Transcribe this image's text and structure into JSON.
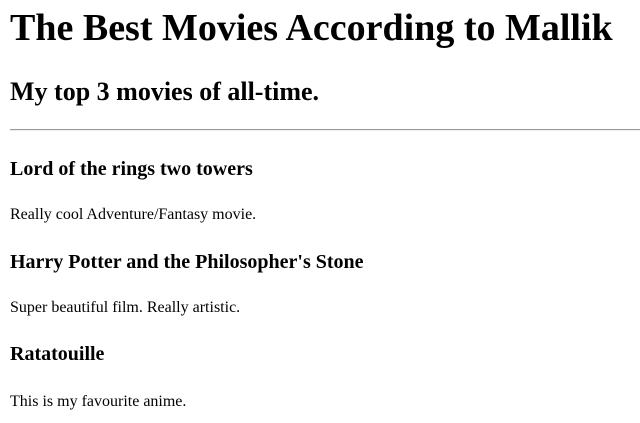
{
  "header": {
    "title": "The Best Movies According to Mallik",
    "subtitle": "My top 3 movies of all-time."
  },
  "movies": [
    {
      "title": "Lord of the rings two towers",
      "description": "Really cool Adventure/Fantasy movie."
    },
    {
      "title": "Harry Potter and the Philosopher's Stone",
      "description": "Super beautiful film. Really artistic."
    },
    {
      "title": "Ratatouille",
      "description": "This is my favourite anime."
    }
  ]
}
